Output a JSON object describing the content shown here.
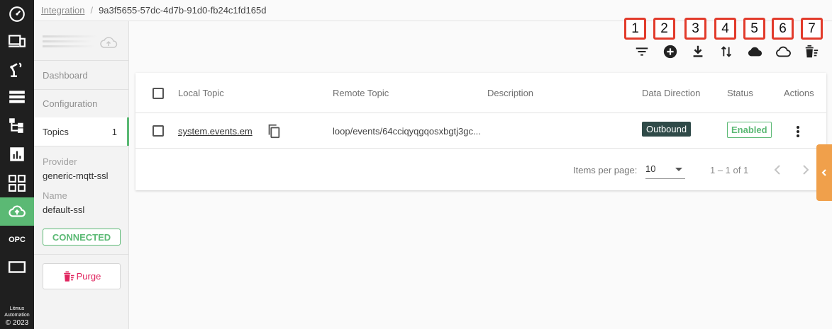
{
  "breadcrumb": {
    "link": "Integration",
    "separator": "/",
    "current": "9a3f5655-57dc-4d7b-91d0-fb24c1fd165d"
  },
  "rail": {
    "items": [
      "dashboard-gauge-icon",
      "devices-icon",
      "robot-arm-icon",
      "list-icon",
      "topology-icon",
      "analytics-icon",
      "apps-grid-icon",
      "cloud-upload-icon",
      "opc",
      "monitor-icon"
    ],
    "opc_label": "OPC",
    "footer_line1": "Litmus",
    "footer_line2": "Automation",
    "footer_copyright": "© 2023"
  },
  "panel": {
    "nav": [
      {
        "label": "Dashboard"
      },
      {
        "label": "Configuration"
      },
      {
        "label": "Topics",
        "count": "1"
      }
    ],
    "provider_label": "Provider",
    "provider_value": "generic-mqtt-ssl",
    "name_label": "Name",
    "name_value": "default-ssl",
    "status": "CONNECTED",
    "purge_label": "Purge"
  },
  "toolbar": {
    "icons": [
      "filter-icon",
      "add-circle-icon",
      "download-icon",
      "swap-vertical-icon",
      "cloud-icon",
      "cloud-outline-icon",
      "delete-sweep-icon"
    ],
    "callouts": [
      "1",
      "2",
      "3",
      "4",
      "5",
      "6",
      "7"
    ]
  },
  "table": {
    "headers": [
      "Local Topic",
      "Remote Topic",
      "Description",
      "Data Direction",
      "Status",
      "Actions"
    ],
    "rows": [
      {
        "local_topic": "system.events.em",
        "remote_topic": "loop/events/64cciqyqgqosxbgtj3gc...",
        "description": "",
        "direction": "Outbound",
        "status": "Enabled"
      }
    ]
  },
  "pager": {
    "items_label": "Items per page:",
    "items_value": "10",
    "range": "1 – 1 of 1"
  },
  "colors": {
    "rail_bg": "#1f1f1f",
    "accent_green": "#5bb974",
    "callout_red": "#e23b2b",
    "outbound_badge": "#2f4a48",
    "side_tab": "#f0a04b",
    "purge_red": "#e0245e"
  }
}
